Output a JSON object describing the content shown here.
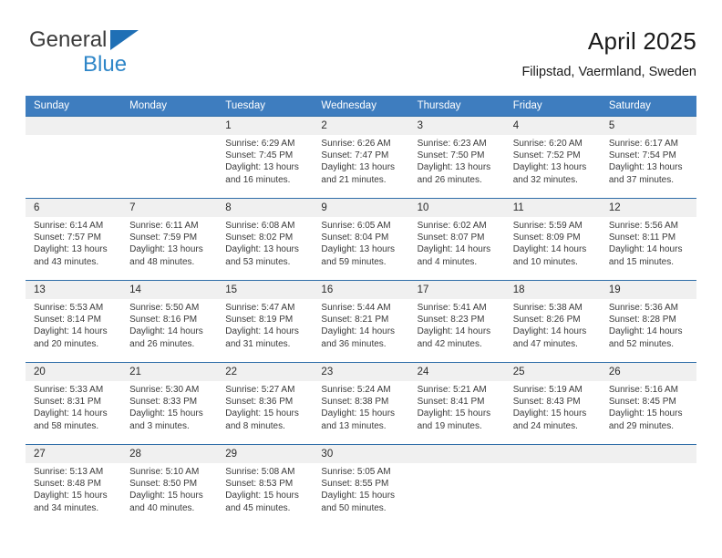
{
  "logo": {
    "word1": "General",
    "word2": "Blue",
    "triangle_icon": "triangle-icon",
    "color_dark": "#3B3B3B",
    "color_blue": "#2E86C8"
  },
  "header": {
    "title": "April 2025",
    "subtitle": "Filipstad, Vaermland, Sweden"
  },
  "colors": {
    "header_blue": "#3E7DBF",
    "row_divider": "#2E6DA8",
    "band_gray": "#F0F0F0"
  },
  "weekdays": [
    "Sunday",
    "Monday",
    "Tuesday",
    "Wednesday",
    "Thursday",
    "Friday",
    "Saturday"
  ],
  "weeks": [
    [
      {
        "day": "",
        "sunrise": "",
        "sunset": "",
        "daylight1": "",
        "daylight2": ""
      },
      {
        "day": "",
        "sunrise": "",
        "sunset": "",
        "daylight1": "",
        "daylight2": ""
      },
      {
        "day": "1",
        "sunrise": "Sunrise: 6:29 AM",
        "sunset": "Sunset: 7:45 PM",
        "daylight1": "Daylight: 13 hours",
        "daylight2": "and 16 minutes."
      },
      {
        "day": "2",
        "sunrise": "Sunrise: 6:26 AM",
        "sunset": "Sunset: 7:47 PM",
        "daylight1": "Daylight: 13 hours",
        "daylight2": "and 21 minutes."
      },
      {
        "day": "3",
        "sunrise": "Sunrise: 6:23 AM",
        "sunset": "Sunset: 7:50 PM",
        "daylight1": "Daylight: 13 hours",
        "daylight2": "and 26 minutes."
      },
      {
        "day": "4",
        "sunrise": "Sunrise: 6:20 AM",
        "sunset": "Sunset: 7:52 PM",
        "daylight1": "Daylight: 13 hours",
        "daylight2": "and 32 minutes."
      },
      {
        "day": "5",
        "sunrise": "Sunrise: 6:17 AM",
        "sunset": "Sunset: 7:54 PM",
        "daylight1": "Daylight: 13 hours",
        "daylight2": "and 37 minutes."
      }
    ],
    [
      {
        "day": "6",
        "sunrise": "Sunrise: 6:14 AM",
        "sunset": "Sunset: 7:57 PM",
        "daylight1": "Daylight: 13 hours",
        "daylight2": "and 43 minutes."
      },
      {
        "day": "7",
        "sunrise": "Sunrise: 6:11 AM",
        "sunset": "Sunset: 7:59 PM",
        "daylight1": "Daylight: 13 hours",
        "daylight2": "and 48 minutes."
      },
      {
        "day": "8",
        "sunrise": "Sunrise: 6:08 AM",
        "sunset": "Sunset: 8:02 PM",
        "daylight1": "Daylight: 13 hours",
        "daylight2": "and 53 minutes."
      },
      {
        "day": "9",
        "sunrise": "Sunrise: 6:05 AM",
        "sunset": "Sunset: 8:04 PM",
        "daylight1": "Daylight: 13 hours",
        "daylight2": "and 59 minutes."
      },
      {
        "day": "10",
        "sunrise": "Sunrise: 6:02 AM",
        "sunset": "Sunset: 8:07 PM",
        "daylight1": "Daylight: 14 hours",
        "daylight2": "and 4 minutes."
      },
      {
        "day": "11",
        "sunrise": "Sunrise: 5:59 AM",
        "sunset": "Sunset: 8:09 PM",
        "daylight1": "Daylight: 14 hours",
        "daylight2": "and 10 minutes."
      },
      {
        "day": "12",
        "sunrise": "Sunrise: 5:56 AM",
        "sunset": "Sunset: 8:11 PM",
        "daylight1": "Daylight: 14 hours",
        "daylight2": "and 15 minutes."
      }
    ],
    [
      {
        "day": "13",
        "sunrise": "Sunrise: 5:53 AM",
        "sunset": "Sunset: 8:14 PM",
        "daylight1": "Daylight: 14 hours",
        "daylight2": "and 20 minutes."
      },
      {
        "day": "14",
        "sunrise": "Sunrise: 5:50 AM",
        "sunset": "Sunset: 8:16 PM",
        "daylight1": "Daylight: 14 hours",
        "daylight2": "and 26 minutes."
      },
      {
        "day": "15",
        "sunrise": "Sunrise: 5:47 AM",
        "sunset": "Sunset: 8:19 PM",
        "daylight1": "Daylight: 14 hours",
        "daylight2": "and 31 minutes."
      },
      {
        "day": "16",
        "sunrise": "Sunrise: 5:44 AM",
        "sunset": "Sunset: 8:21 PM",
        "daylight1": "Daylight: 14 hours",
        "daylight2": "and 36 minutes."
      },
      {
        "day": "17",
        "sunrise": "Sunrise: 5:41 AM",
        "sunset": "Sunset: 8:23 PM",
        "daylight1": "Daylight: 14 hours",
        "daylight2": "and 42 minutes."
      },
      {
        "day": "18",
        "sunrise": "Sunrise: 5:38 AM",
        "sunset": "Sunset: 8:26 PM",
        "daylight1": "Daylight: 14 hours",
        "daylight2": "and 47 minutes."
      },
      {
        "day": "19",
        "sunrise": "Sunrise: 5:36 AM",
        "sunset": "Sunset: 8:28 PM",
        "daylight1": "Daylight: 14 hours",
        "daylight2": "and 52 minutes."
      }
    ],
    [
      {
        "day": "20",
        "sunrise": "Sunrise: 5:33 AM",
        "sunset": "Sunset: 8:31 PM",
        "daylight1": "Daylight: 14 hours",
        "daylight2": "and 58 minutes."
      },
      {
        "day": "21",
        "sunrise": "Sunrise: 5:30 AM",
        "sunset": "Sunset: 8:33 PM",
        "daylight1": "Daylight: 15 hours",
        "daylight2": "and 3 minutes."
      },
      {
        "day": "22",
        "sunrise": "Sunrise: 5:27 AM",
        "sunset": "Sunset: 8:36 PM",
        "daylight1": "Daylight: 15 hours",
        "daylight2": "and 8 minutes."
      },
      {
        "day": "23",
        "sunrise": "Sunrise: 5:24 AM",
        "sunset": "Sunset: 8:38 PM",
        "daylight1": "Daylight: 15 hours",
        "daylight2": "and 13 minutes."
      },
      {
        "day": "24",
        "sunrise": "Sunrise: 5:21 AM",
        "sunset": "Sunset: 8:41 PM",
        "daylight1": "Daylight: 15 hours",
        "daylight2": "and 19 minutes."
      },
      {
        "day": "25",
        "sunrise": "Sunrise: 5:19 AM",
        "sunset": "Sunset: 8:43 PM",
        "daylight1": "Daylight: 15 hours",
        "daylight2": "and 24 minutes."
      },
      {
        "day": "26",
        "sunrise": "Sunrise: 5:16 AM",
        "sunset": "Sunset: 8:45 PM",
        "daylight1": "Daylight: 15 hours",
        "daylight2": "and 29 minutes."
      }
    ],
    [
      {
        "day": "27",
        "sunrise": "Sunrise: 5:13 AM",
        "sunset": "Sunset: 8:48 PM",
        "daylight1": "Daylight: 15 hours",
        "daylight2": "and 34 minutes."
      },
      {
        "day": "28",
        "sunrise": "Sunrise: 5:10 AM",
        "sunset": "Sunset: 8:50 PM",
        "daylight1": "Daylight: 15 hours",
        "daylight2": "and 40 minutes."
      },
      {
        "day": "29",
        "sunrise": "Sunrise: 5:08 AM",
        "sunset": "Sunset: 8:53 PM",
        "daylight1": "Daylight: 15 hours",
        "daylight2": "and 45 minutes."
      },
      {
        "day": "30",
        "sunrise": "Sunrise: 5:05 AM",
        "sunset": "Sunset: 8:55 PM",
        "daylight1": "Daylight: 15 hours",
        "daylight2": "and 50 minutes."
      },
      {
        "day": "",
        "sunrise": "",
        "sunset": "",
        "daylight1": "",
        "daylight2": ""
      },
      {
        "day": "",
        "sunrise": "",
        "sunset": "",
        "daylight1": "",
        "daylight2": ""
      },
      {
        "day": "",
        "sunrise": "",
        "sunset": "",
        "daylight1": "",
        "daylight2": ""
      }
    ]
  ]
}
